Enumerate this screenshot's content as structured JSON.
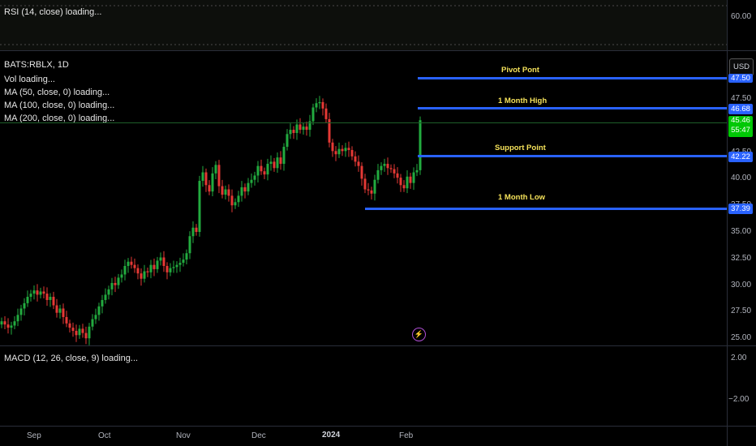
{
  "rsi": {
    "label": "RSI (14, close) loading...",
    "axis_value": "60.00"
  },
  "main": {
    "symbol": "BATS:RBLX, 1D",
    "indicators": [
      "Vol loading...",
      "MA (50, close, 0) loading...",
      "MA (100, close, 0) loading...",
      "MA (200, close, 0) loading..."
    ],
    "currency_button": "USD",
    "price_ticks": [
      "47.50",
      "45.00",
      "42.50",
      "40.00",
      "37.50",
      "35.00",
      "32.50",
      "30.00",
      "27.50",
      "25.00"
    ],
    "levels": [
      {
        "label": "Pivot Pont",
        "tag": "47.50",
        "color": "#2962ff"
      },
      {
        "label": "1 Month High",
        "tag": "46.68",
        "color": "#2962ff"
      },
      {
        "label": "Support Point",
        "tag": "42.22",
        "color": "#2962ff"
      },
      {
        "label": "1 Month Low",
        "tag": "37.39",
        "color": "#2962ff"
      }
    ],
    "last_price": {
      "value": "45.46",
      "countdown": "55:47",
      "color": "#00c805"
    },
    "candle_colors": {
      "up": "#22ab3f",
      "down": "#e53935"
    }
  },
  "macd": {
    "label": "MACD (12, 26, close, 9) loading...",
    "axis_values": [
      "2.00",
      "−2.00"
    ]
  },
  "time_axis": [
    "Sep",
    "Oct",
    "Nov",
    "Dec",
    "2024",
    "Feb"
  ],
  "icons": {
    "alert": "lightning-bolt-icon"
  }
}
